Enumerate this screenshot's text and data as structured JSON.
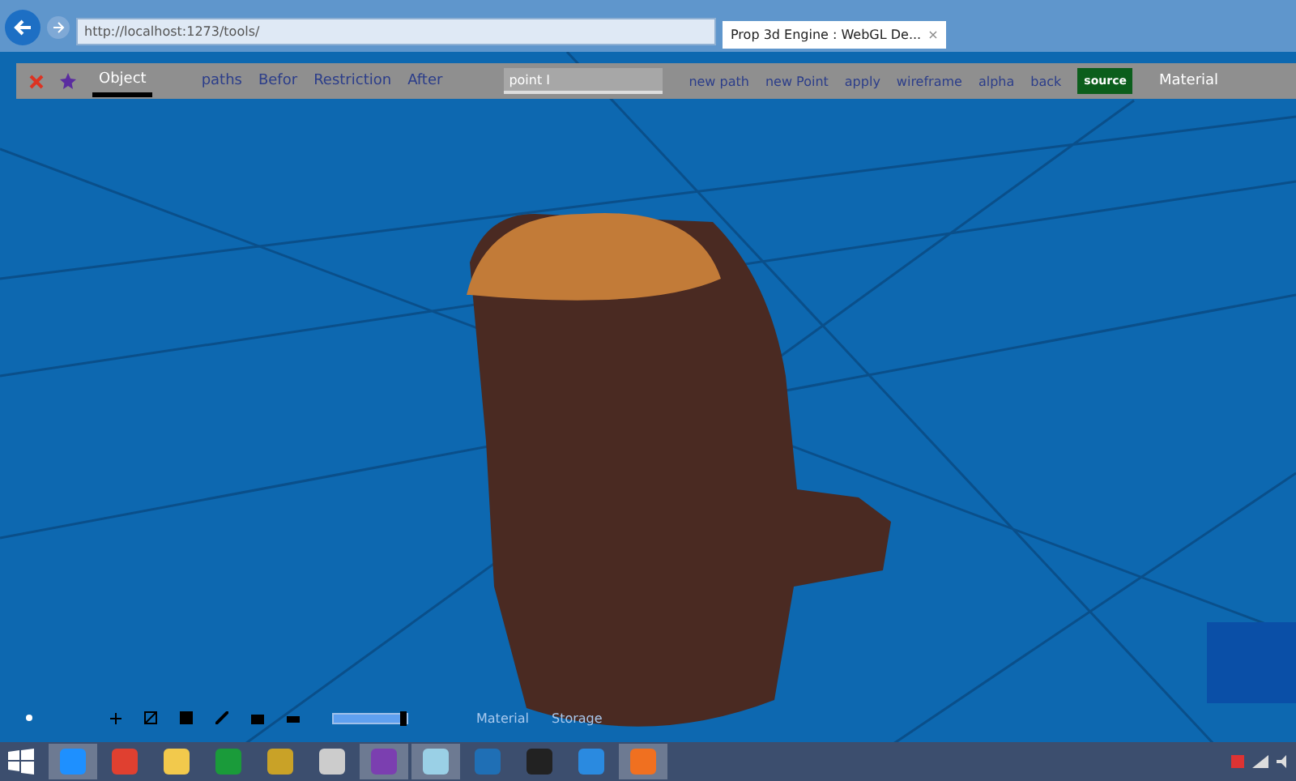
{
  "browser": {
    "url": "http://localhost:1273/tools/",
    "tab_title": "Prop 3d Engine : WebGL De...",
    "tab_close": "×"
  },
  "toolbar": {
    "tabs": [
      {
        "label": "Object",
        "selected": true
      }
    ],
    "links": [
      "paths",
      "Befor",
      "Restriction",
      "After"
    ],
    "input": {
      "value": "point I"
    },
    "actions": [
      {
        "label": "new path",
        "kind": "link"
      },
      {
        "label": "new Point",
        "kind": "link"
      },
      {
        "label": "apply",
        "kind": "link"
      },
      {
        "label": "wireframe",
        "kind": "link"
      },
      {
        "label": "alpha",
        "kind": "link"
      },
      {
        "label": "back",
        "kind": "link"
      },
      {
        "label": "source",
        "kind": "button"
      },
      {
        "label": "Material",
        "kind": "tab"
      }
    ]
  },
  "bottom_tools": {
    "slider": {
      "level": 0.95
    },
    "labels": [
      "Material",
      "Storage"
    ]
  },
  "taskbar": {
    "apps": [
      {
        "kind": "ie",
        "selected": true
      },
      {
        "kind": "chrome",
        "selected": false
      },
      {
        "kind": "folder",
        "selected": false
      },
      {
        "kind": "store",
        "selected": false
      },
      {
        "kind": "tools",
        "selected": false
      },
      {
        "kind": "eye",
        "selected": false
      },
      {
        "kind": "vs",
        "selected": true
      },
      {
        "kind": "notepad",
        "selected": true
      },
      {
        "kind": "ps",
        "selected": false
      },
      {
        "kind": "inkscape",
        "selected": false
      },
      {
        "kind": "maxthon",
        "selected": false
      },
      {
        "kind": "firefox",
        "selected": true
      }
    ]
  }
}
